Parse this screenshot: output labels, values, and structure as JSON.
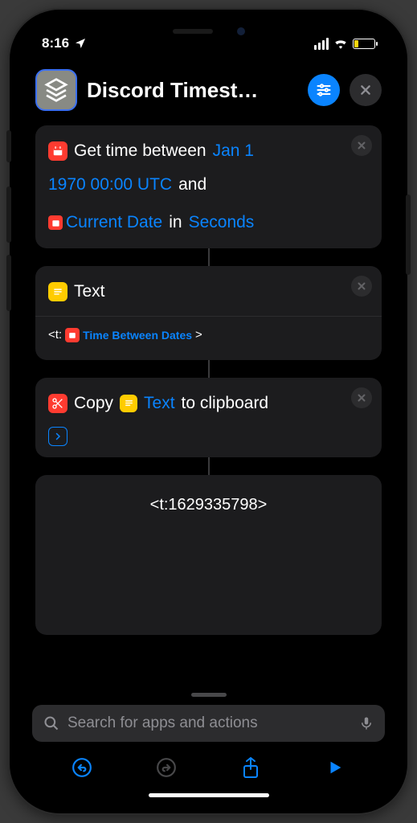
{
  "status": {
    "time": "8:16"
  },
  "header": {
    "title": "Discord Timest…"
  },
  "actions": {
    "a1": {
      "verb": "Get time between",
      "date1": "Jan 1",
      "date1b": "1970 00:00 UTC",
      "and": "and",
      "date2": "Current Date",
      "in": "in",
      "unit": "Seconds"
    },
    "a2": {
      "label": "Text",
      "body_pre": "<t:",
      "body_var": "Time Between Dates",
      "body_post": ">"
    },
    "a3": {
      "verb": "Copy",
      "var": "Text",
      "rest": "to clipboard"
    }
  },
  "output": "<t:1629335798>",
  "search": {
    "placeholder": "Search for apps and actions"
  }
}
